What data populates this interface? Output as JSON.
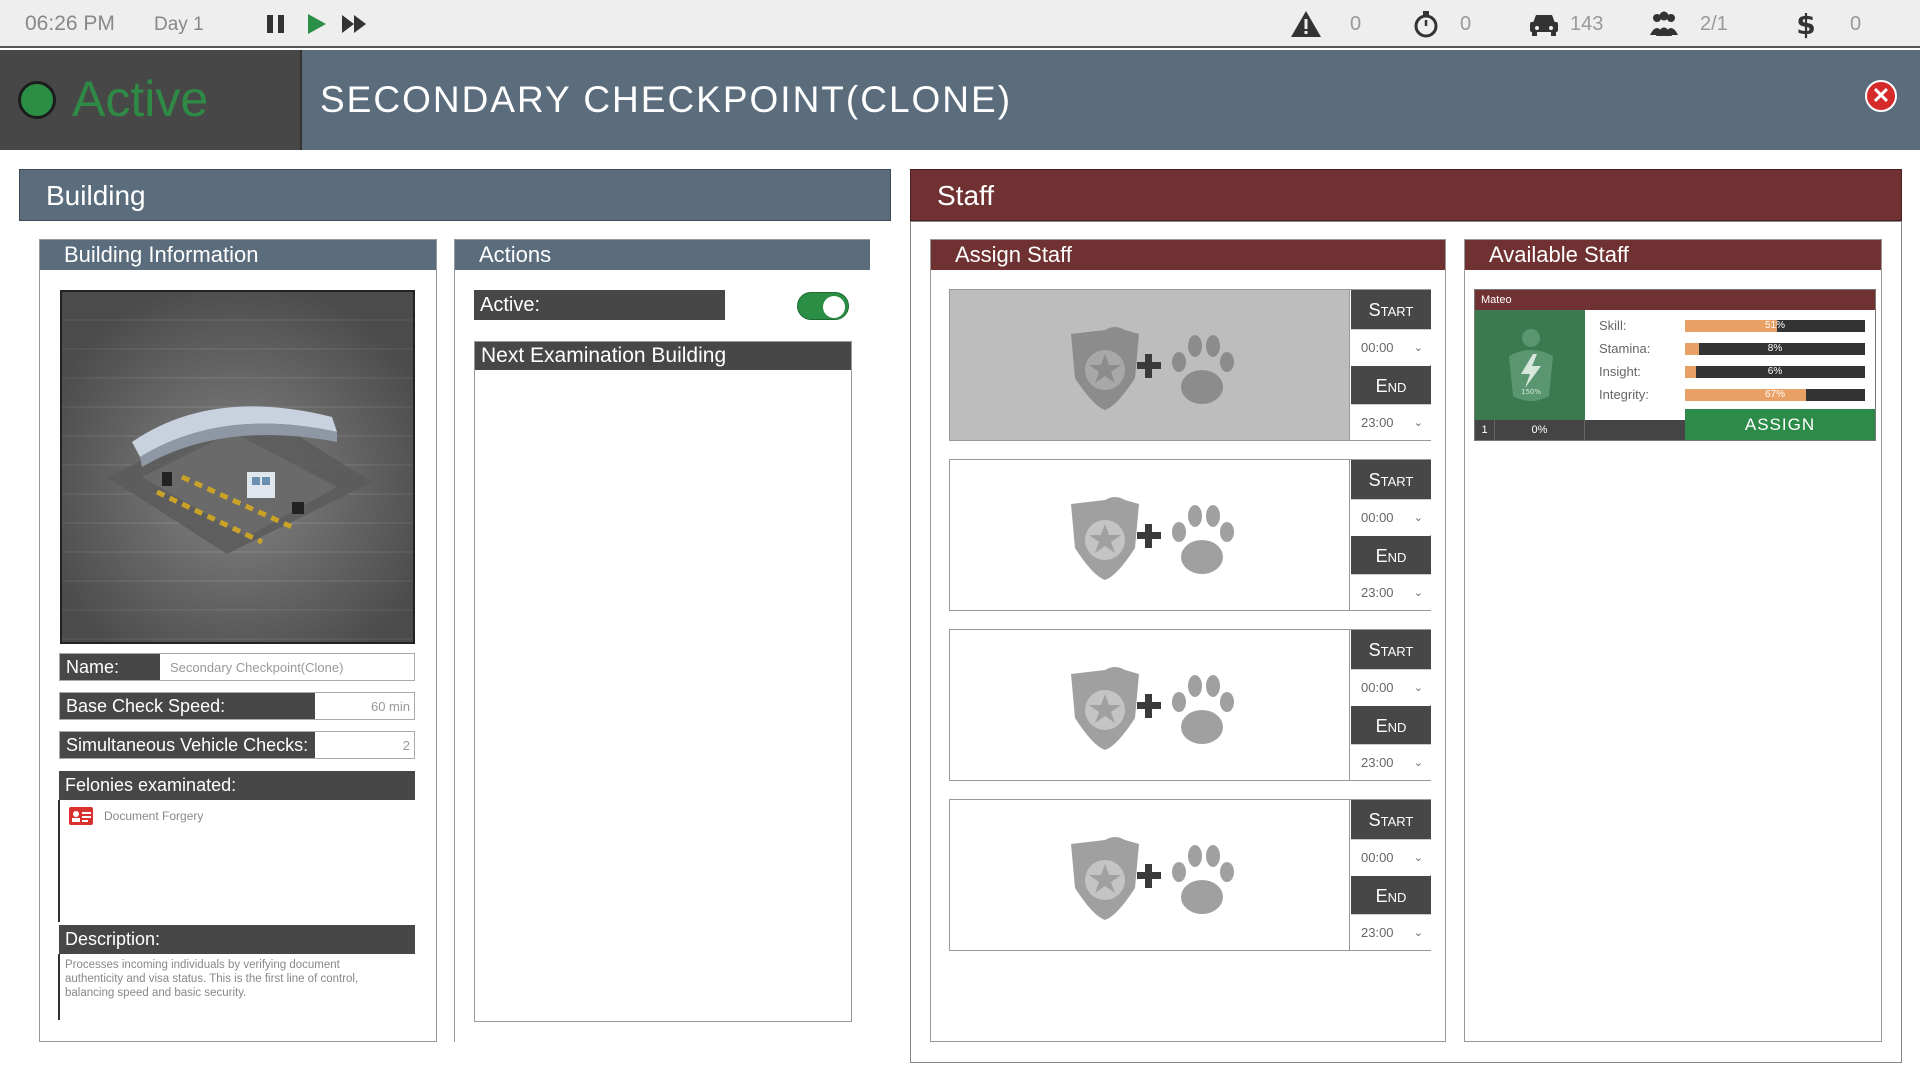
{
  "topbar": {
    "time": "06:26 PM",
    "day": "Day 1",
    "stats": {
      "alerts": "0",
      "timer": "0",
      "vehicles": "143",
      "staff": "2/1",
      "money": "0"
    }
  },
  "status": {
    "label": "Active",
    "color": "#2a8f45"
  },
  "window_title": "SECONDARY CHECKPOINT(CLONE)",
  "sections": {
    "building": "Building",
    "staff": "Staff"
  },
  "building_info": {
    "title": "Building Information",
    "name_label": "Name:",
    "name_value": "Secondary Checkpoint(Clone)",
    "speed_label": "Base Check Speed:",
    "speed_value": "60 min",
    "simul_label": "Simultaneous Vehicle Checks:",
    "simul_value": "2",
    "felonies_label": "Felonies examinated:",
    "felonies": [
      "Document Forgery"
    ],
    "description_label": "Description:",
    "description": "Processes incoming individuals by verifying document authenticity and visa status. This is the first line of control, balancing speed and basic security."
  },
  "actions": {
    "title": "Actions",
    "active_label": "Active:",
    "active_on": true,
    "next_building_label": "Next Examination Building"
  },
  "assign": {
    "title": "Assign Staff",
    "slots": [
      {
        "start_label": "Start",
        "start_time": "00:00",
        "end_label": "End",
        "end_time": "23:00"
      },
      {
        "start_label": "Start",
        "start_time": "00:00",
        "end_label": "End",
        "end_time": "23:00"
      },
      {
        "start_label": "Start",
        "start_time": "00:00",
        "end_label": "End",
        "end_time": "23:00"
      },
      {
        "start_label": "Start",
        "start_time": "00:00",
        "end_label": "End",
        "end_time": "23:00"
      }
    ]
  },
  "available": {
    "title": "Available Staff",
    "staff": [
      {
        "name": "Mateo",
        "photo_badge": "150%",
        "level": "1",
        "xp": "0%",
        "assign_label": "ASSIGN",
        "stats": [
          {
            "label": "Skill:",
            "pct_label": "51%",
            "value": 0.51
          },
          {
            "label": "Stamina:",
            "pct_label": "8%",
            "value": 0.08
          },
          {
            "label": "Insight:",
            "pct_label": "6%",
            "value": 0.06
          },
          {
            "label": "Integrity:",
            "pct_label": "67%",
            "value": 0.67
          }
        ]
      }
    ]
  },
  "colors": {
    "building_header": "#5b6d7d",
    "staff_header": "#6f3131",
    "accent_green": "#2a8f45",
    "stat_fill": "#e8a064"
  },
  "icons": [
    "pause-icon",
    "play-icon",
    "fast-forward-icon",
    "warning-icon",
    "stopwatch-icon",
    "car-icon",
    "people-icon",
    "dollar-icon",
    "close-icon",
    "badge-paw-icon",
    "document-forgery-icon"
  ]
}
